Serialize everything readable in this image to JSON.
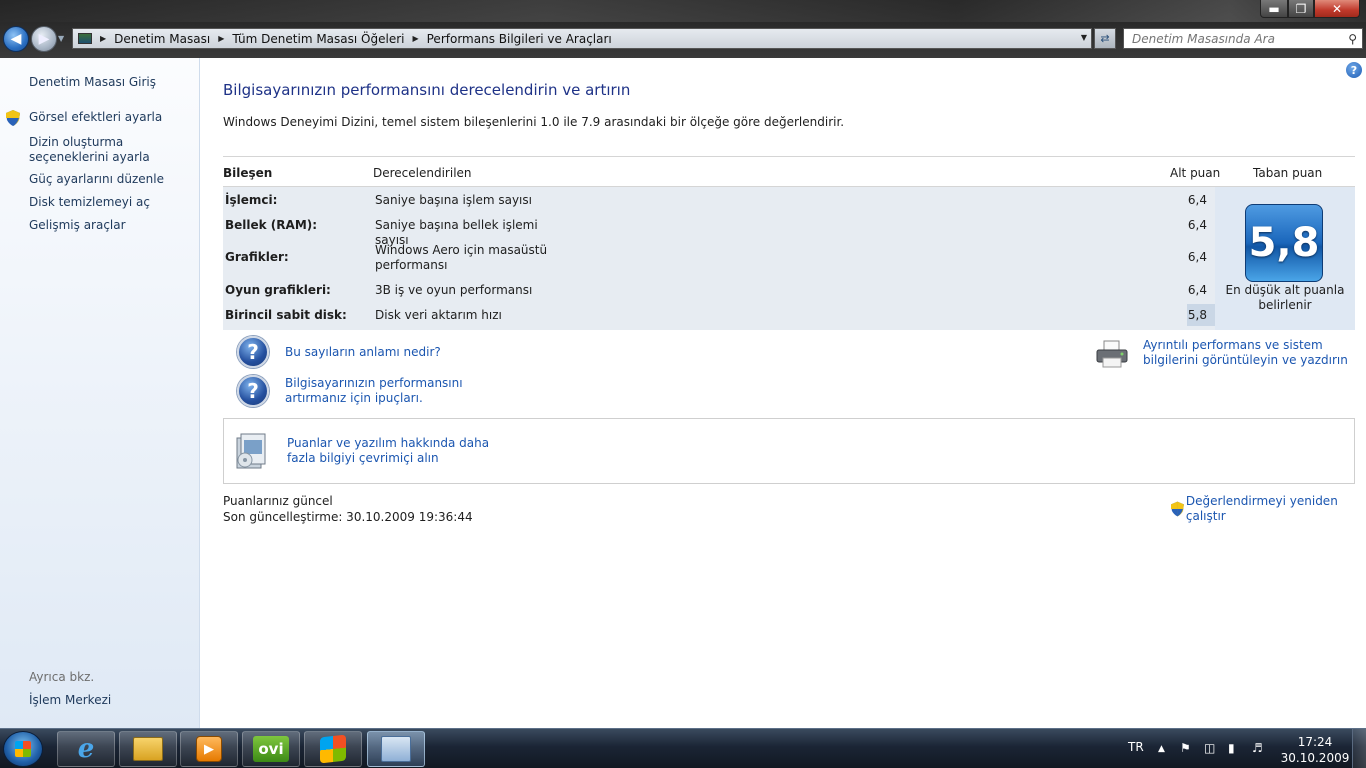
{
  "window": {
    "minimize": "▬",
    "maximize": "❐",
    "close": "✕"
  },
  "address_bar": {
    "breadcrumbs": [
      "Denetim Masası",
      "Tüm Denetim Masası Öğeleri",
      "Performans Bilgileri ve Araçları"
    ],
    "search_placeholder": "Denetim Masasında Ara"
  },
  "sidebar": {
    "home": "Denetim Masası Giriş",
    "items": [
      {
        "label": "Görsel efektleri ayarla",
        "icon": "uac-shield-icon"
      },
      {
        "label": "Dizin oluşturma seçeneklerini ayarla"
      },
      {
        "label": "Güç ayarlarını düzenle"
      },
      {
        "label": "Disk temizlemeyi aç"
      },
      {
        "label": "Gelişmiş araçlar"
      }
    ],
    "see_also": "Ayrıca bkz.",
    "see_also_link": "İşlem Merkezi"
  },
  "main": {
    "help": "?",
    "title": "Bilgisayarınızın performansını derecelendirin ve artırın",
    "description": "Windows Deneyimi Dizini, temel sistem bileşenlerini 1.0 ile 7.9 arasındaki bir ölçeğe göre değerlendirir.",
    "table": {
      "headers": {
        "component": "Bileşen",
        "rated": "Derecelendirilen",
        "subscore": "Alt puan",
        "base": "Taban puan"
      },
      "rows": [
        {
          "component": "İşlemci:",
          "desc": "Saniye başına işlem sayısı",
          "score": "6,4"
        },
        {
          "component": "Bellek (RAM):",
          "desc": "Saniye başına bellek işlemi sayısı",
          "score": "6,4"
        },
        {
          "component": "Grafikler:",
          "desc": "Windows Aero için masaüstü performansı",
          "score": "6,4"
        },
        {
          "component": "Oyun grafikleri:",
          "desc": "3B iş ve oyun performansı",
          "score": "6,4"
        },
        {
          "component": "Birincil sabit disk:",
          "desc": "Disk veri aktarım hızı",
          "score": "5,8"
        }
      ],
      "base_score": "5,8",
      "base_caption": "En düşük alt puanla belirlenir"
    },
    "links": {
      "meaning": "Bu sayıların anlamı nedir?",
      "tips": "Bilgisayarınızın performansını artırmanız için ipuçları.",
      "print_details": "Ayrıntılı performans ve sistem bilgilerini görüntüleyin ve yazdırın",
      "online": "Puanlar ve yazılım hakkında daha fazla bilgiyi çevrimiçi alın",
      "rerun": "Değerlendirmeyi yeniden çalıştır"
    },
    "status": {
      "current": "Puanlarınız güncel",
      "last_update": "Son güncelleştirme: 30.10.2009 19:36:44"
    }
  },
  "taskbar": {
    "apps": [
      {
        "name": "internet-explorer"
      },
      {
        "name": "windows-explorer"
      },
      {
        "name": "media-player"
      },
      {
        "name": "ovi",
        "label": "ovi"
      },
      {
        "name": "windows-update"
      },
      {
        "name": "performance-info",
        "active": true
      }
    ],
    "language": "TR",
    "time": "17:24",
    "date": "30.10.2009"
  }
}
